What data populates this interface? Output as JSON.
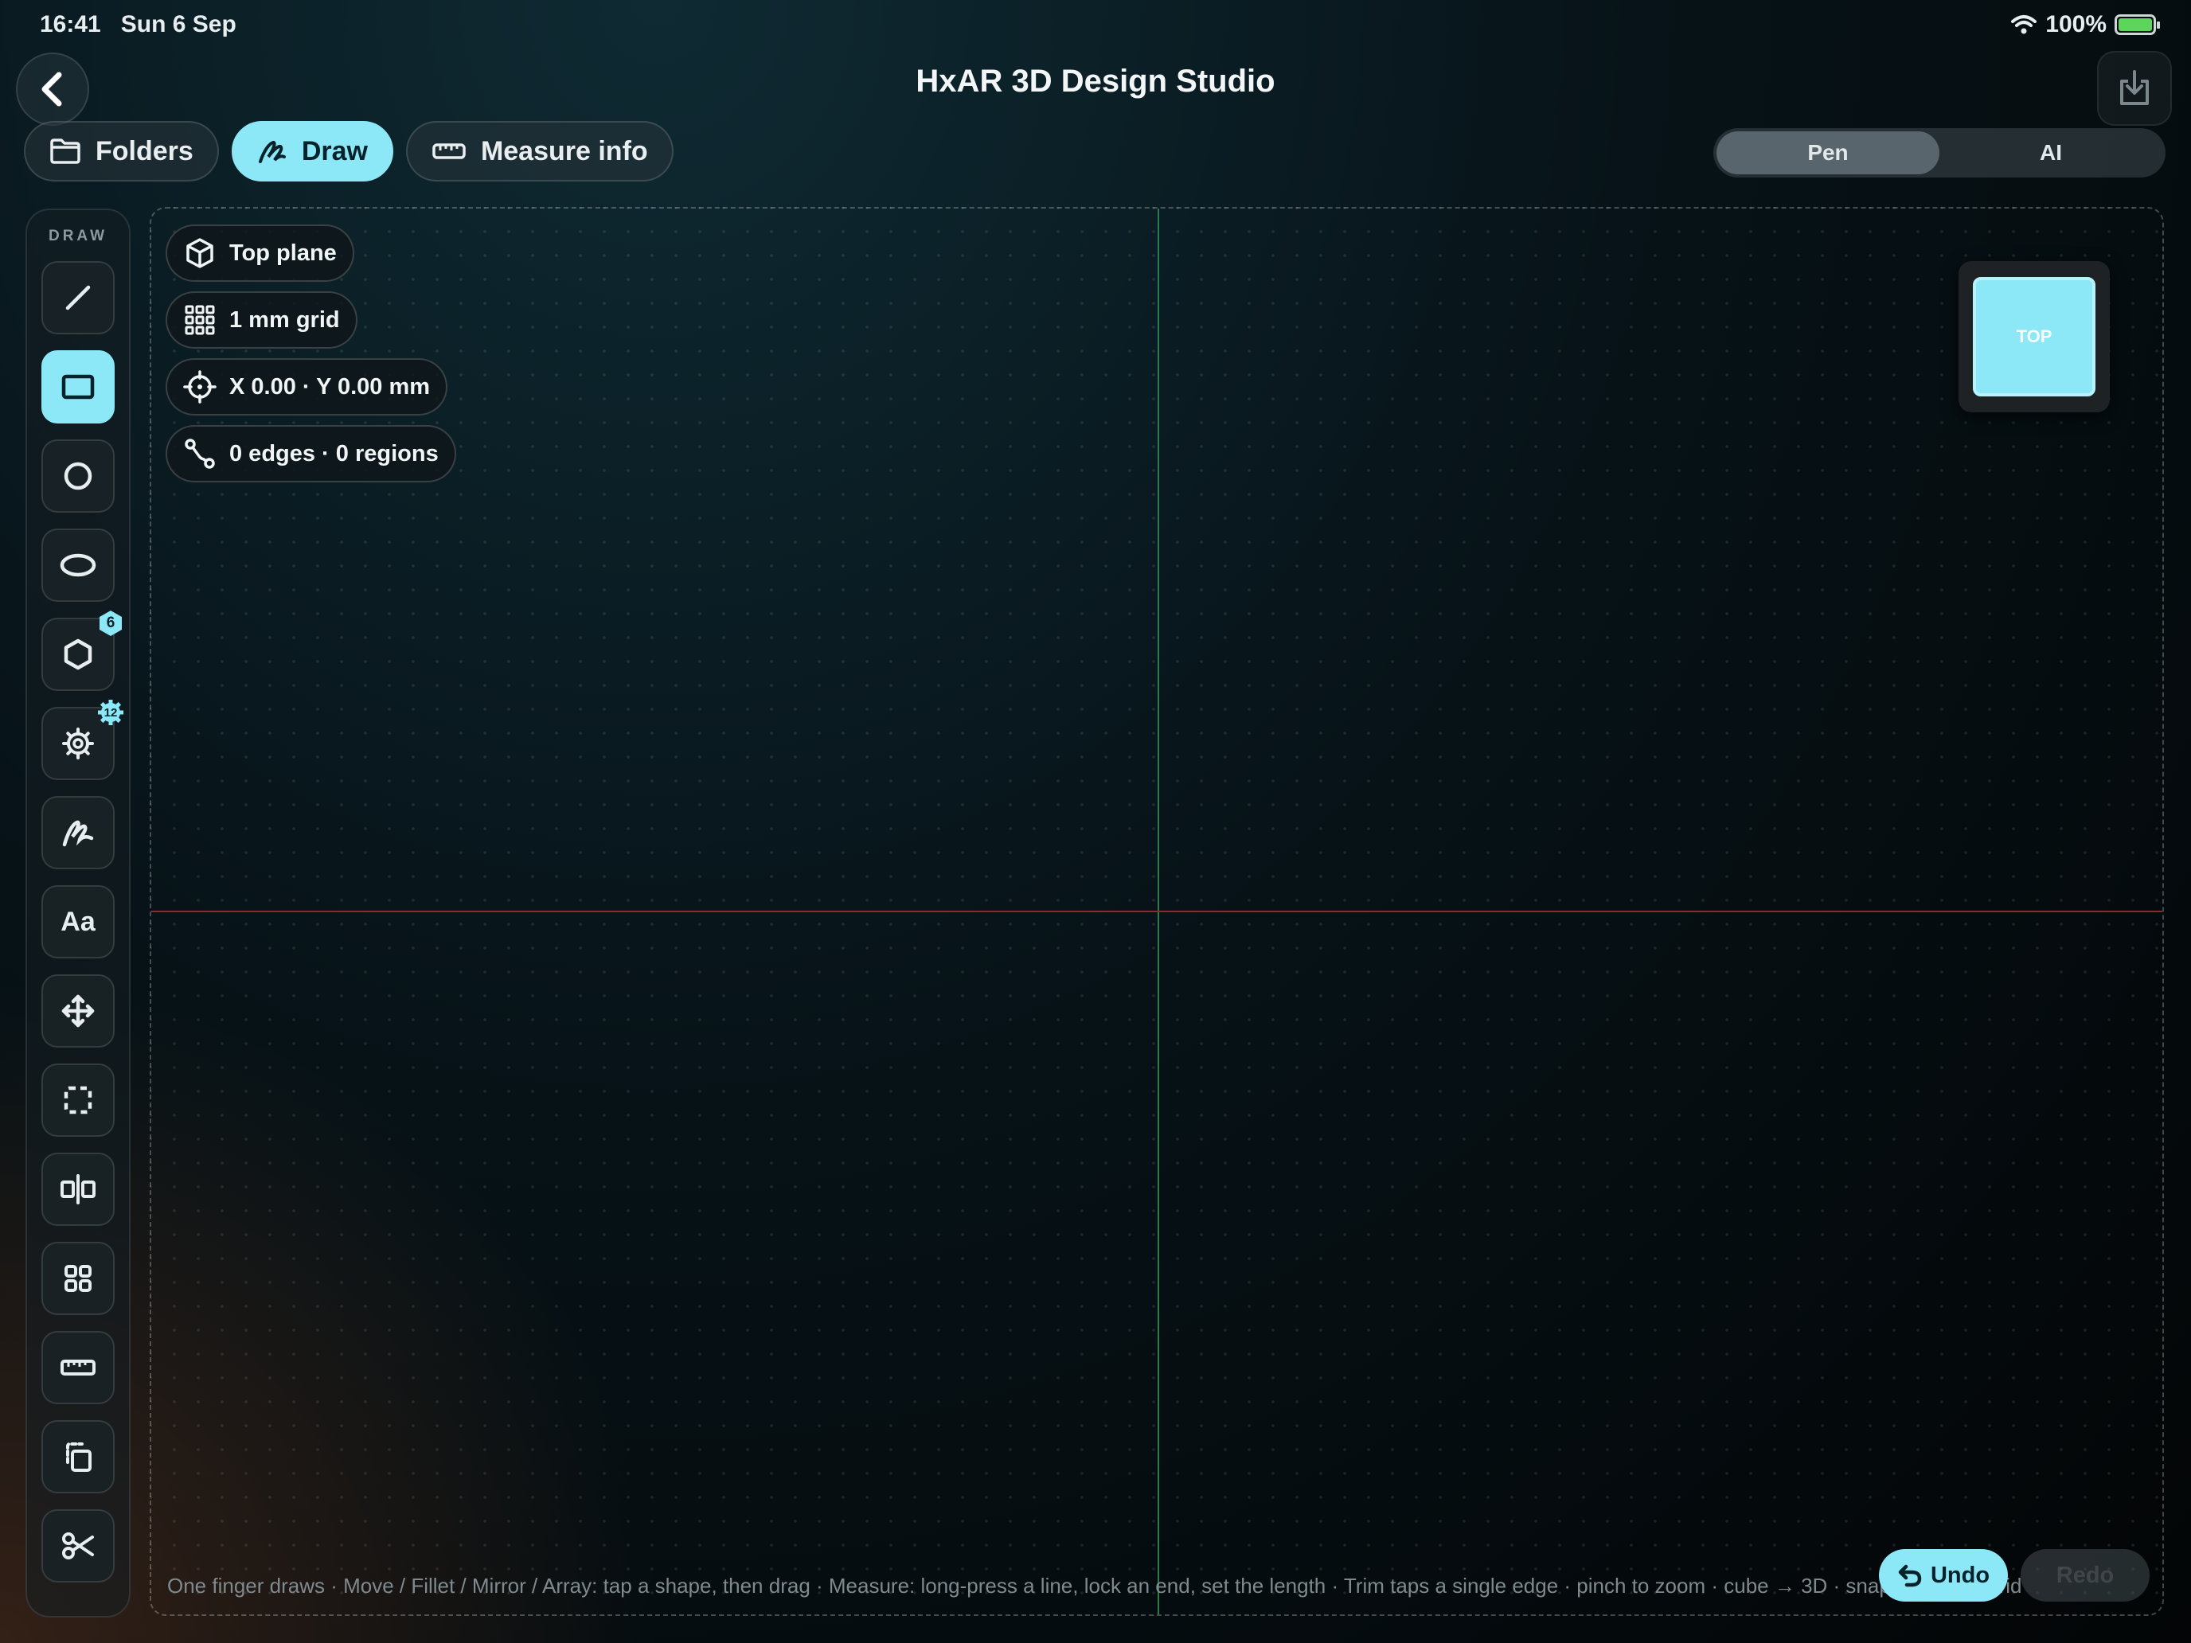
{
  "status_bar": {
    "time": "16:41",
    "date": "Sun 6 Sep",
    "battery": "100%"
  },
  "header": {
    "title": "HxAR 3D Design Studio"
  },
  "tabs": [
    {
      "label": "Folders",
      "icon": "folder-icon",
      "active": false
    },
    {
      "label": "Draw",
      "icon": "draw-icon",
      "active": true
    },
    {
      "label": "Measure info",
      "icon": "ruler-icon",
      "active": false
    }
  ],
  "mode_toggle": {
    "options": [
      "Pen",
      "AI"
    ],
    "selected": "Pen"
  },
  "toolbar": {
    "label": "DRAW",
    "tools": [
      {
        "name": "line-tool",
        "icon": "line-icon"
      },
      {
        "name": "rectangle-tool",
        "icon": "rectangle-icon",
        "active": true
      },
      {
        "name": "circle-tool",
        "icon": "circle-icon"
      },
      {
        "name": "ellipse-tool",
        "icon": "ellipse-icon"
      },
      {
        "name": "polygon-tool",
        "icon": "hexagon-icon",
        "badge": "6"
      },
      {
        "name": "gear-tool",
        "icon": "gear-icon",
        "badge": "12"
      },
      {
        "name": "freehand-tool",
        "icon": "scribble-icon"
      },
      {
        "name": "text-tool",
        "icon": "text-icon",
        "label": "Aa"
      },
      {
        "name": "move-tool",
        "icon": "move-icon"
      },
      {
        "name": "select-tool",
        "icon": "select-icon"
      },
      {
        "name": "mirror-tool",
        "icon": "mirror-icon"
      },
      {
        "name": "array-tool",
        "icon": "grid-icon"
      },
      {
        "name": "measure-tool",
        "icon": "ruler-icon"
      },
      {
        "name": "copy-tool",
        "icon": "copy-icon"
      },
      {
        "name": "trim-tool",
        "icon": "scissors-icon"
      }
    ]
  },
  "canvas": {
    "plane": "Top plane",
    "grid": "1 mm grid",
    "coordinates": "X 0.00 · Y 0.00 mm",
    "counts": "0 edges · 0 regions",
    "viewcube_label": "TOP",
    "hint": "One finger draws · Move / Fillet / Mirror / Array: tap a shape, then drag · Measure: long-press a line, lock an end, set the length · Trim taps a single edge · pinch to zoom · cube → 3D · snaps to 1 mm grid"
  },
  "actions": {
    "undo": "Undo",
    "redo": "Redo"
  },
  "colors": {
    "accent": "#8ce8f6",
    "x_axis": "#8a2b33",
    "y_axis": "#2d7a4a"
  }
}
